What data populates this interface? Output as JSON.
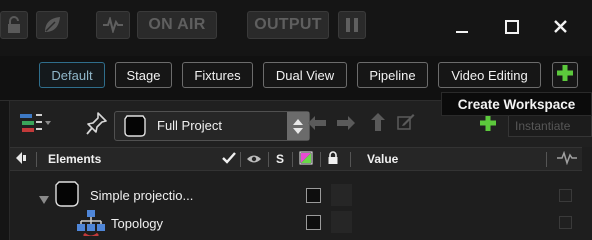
{
  "topbar": {
    "on_air_label": "ON AIR",
    "output_label": "OUTPUT"
  },
  "workspaces": {
    "tabs": [
      {
        "label": "Default",
        "active": true
      },
      {
        "label": "Stage"
      },
      {
        "label": "Fixtures"
      },
      {
        "label": "Dual View"
      },
      {
        "label": "Pipeline"
      },
      {
        "label": "Video Editing"
      }
    ],
    "add_tooltip": "Create Workspace"
  },
  "panel": {
    "project_selector": "Full Project",
    "instantiate_placeholder": "Instantiate",
    "columns": {
      "elements": "Elements",
      "solo": "S",
      "value": "Value"
    },
    "tree": [
      {
        "label": "Simple projectio..."
      },
      {
        "label": "Topology"
      }
    ]
  },
  "colors": {
    "accent_green": "#5cc93c",
    "active_tab_border": "#2f6e8c",
    "background": "#111111"
  }
}
